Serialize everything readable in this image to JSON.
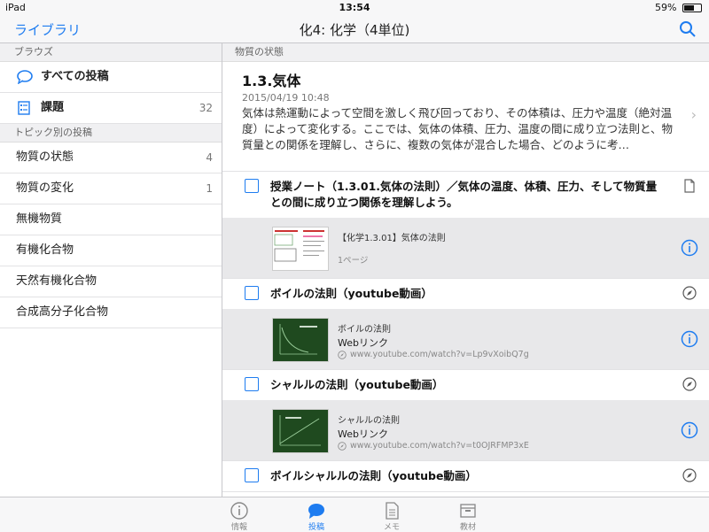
{
  "status": {
    "device": "iPad",
    "time": "13:54",
    "battery": "59%"
  },
  "nav": {
    "back": "ライブラリ",
    "title": "化4: 化学（4単位)"
  },
  "sidebar": {
    "browse_header": "ブラウズ",
    "all_posts": "すべての投稿",
    "tasks": {
      "label": "課題",
      "count": "32"
    },
    "topic_header": "トピック別の投稿",
    "topics": [
      {
        "label": "物質の状態",
        "count": "4"
      },
      {
        "label": "物質の変化",
        "count": "1"
      },
      {
        "label": "無機物質",
        "count": ""
      },
      {
        "label": "有機化合物",
        "count": ""
      },
      {
        "label": "天然有機化合物",
        "count": ""
      },
      {
        "label": "合成高分子化合物",
        "count": ""
      }
    ]
  },
  "main": {
    "section_header": "物質の状態",
    "topic": {
      "title": "1.3.気体",
      "date": "2015/04/19 10:48",
      "desc": "気体は熱運動によって空間を激しく飛び回っており、その体積は、圧力や温度（絶対温度）によって変化する。ここでは、気体の体積、圧力、温度の間に成り立つ法則と、物質量との関係を理解し、さらに、複数の気体が混合した場合、どのように考…"
    },
    "items": [
      {
        "title": "授業ノート（1.3.01.気体の法則）／気体の温度、体積、圧力、そして物質量との間に成り立つ関係を理解しよう。",
        "card_title": "【化学1.3.01】気体の法則",
        "card_sub": "",
        "card_meta": "1ページ"
      },
      {
        "title": "ボイルの法則（youtube動画）",
        "card_title": "ボイルの法則",
        "card_sub": "Webリンク",
        "card_meta": "www.youtube.com/watch?v=Lp9vXoibQ7g"
      },
      {
        "title": "シャルルの法則（youtube動画）",
        "card_title": "シャルルの法則",
        "card_sub": "Webリンク",
        "card_meta": "www.youtube.com/watch?v=t0OJRFMP3xE"
      },
      {
        "title": "ボイルシャルルの法則（youtube動画）"
      }
    ]
  },
  "tabs": [
    "情報",
    "投稿",
    "メモ",
    "教材"
  ],
  "colors": {
    "accent": "#1e7cf0"
  }
}
